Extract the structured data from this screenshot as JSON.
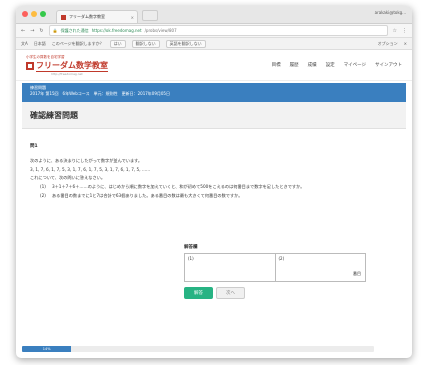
{
  "browser": {
    "tab_title": "フリーダム数字教室",
    "user": "arakaki@tokg...",
    "url_secure": "保護された通信",
    "url_domain": "https://ok.freedomag.net",
    "url_path": "/probs/view/807",
    "translate_label": "日本語",
    "translate_msg": "このページを翻訳しますか？",
    "translate_yes": "はい",
    "translate_no": "翻訳しない",
    "translate_never": "英語を翻訳しない",
    "translate_options": "オプション"
  },
  "site": {
    "logo_sub": "小学生の算数を自宅学習",
    "logo_name": "フリーダム数学教室",
    "logo_url": "http://freedomag.net",
    "nav": [
      "目標",
      "履歴",
      "成績",
      "設定",
      "マイページ",
      "サインアウト"
    ]
  },
  "info": {
    "line1": "練習問題",
    "line2": "2017年 第15回　6年Webコース　単元：規則性　更新日：2017年09月05日"
  },
  "page_title": "確認練習問題",
  "question": {
    "number": "問1",
    "intro": "次のように、ある決まりにしたがって数字が並んでいます。",
    "sequence": "3, 1, 7, 6, 1, 7, 5, 3, 1, 7, 6, 1, 7, 5, 3, 1, 7, 6, 1, 7, 5, ……",
    "ask": "これについて、次の問いに答えなさい。",
    "items": [
      {
        "num": "(1)",
        "text": "3＋1＋7＋6＋……のように、はじめから順に数字を加えていくと、和が初めて500をこえるのは何番目まで数字を足したときですか。"
      },
      {
        "num": "(2)",
        "text": "ある番目の数までに1と7は合計で63個ありました。ある番目の数は最も大きくて何番目の数ですか。"
      }
    ]
  },
  "answer": {
    "label": "解答欄",
    "cell1_label": "(1)",
    "cell2_label": "(2)",
    "unit": "番目"
  },
  "buttons": {
    "submit": "解答",
    "next": "次へ"
  },
  "progress": {
    "label": "14%",
    "value": 14
  },
  "colors": {
    "accent_blue": "#3a7fbf",
    "brand_red": "#c0392b",
    "submit_green": "#27b383"
  }
}
